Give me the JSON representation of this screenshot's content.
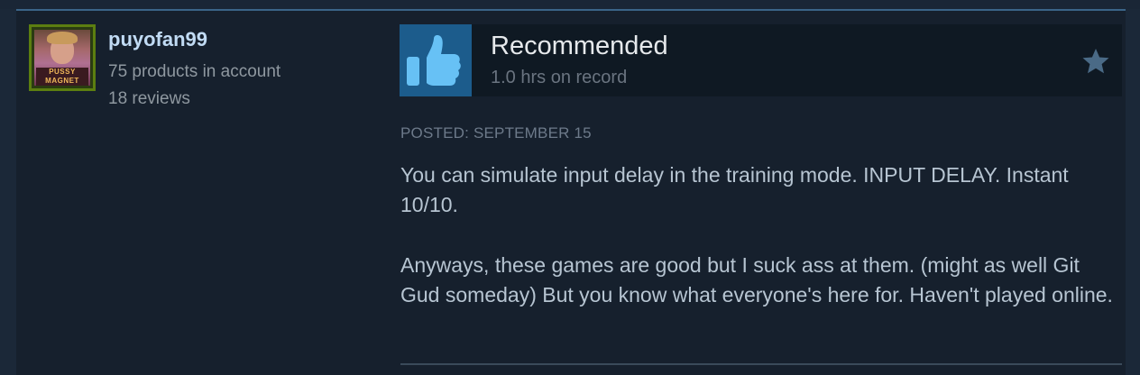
{
  "author": {
    "persona_name": "puyofan99",
    "products_in_account": "75 products in account",
    "reviews_count": "18 reviews",
    "avatar_caption": "PUSSY MAGNET"
  },
  "review": {
    "verdict": "Recommended",
    "hours_on_record": "1.0 hrs on record",
    "posted_date": "POSTED: SEPTEMBER 15",
    "paragraphs": [
      "You can simulate input delay in the training mode. INPUT DELAY. Instant 10/10.",
      "Anyways, these games are good but I suck ass at them. (might as well Git Gud someday) But you know what everyone's here for. Haven't played online."
    ]
  },
  "icons": {
    "thumb": "thumbs-up-icon",
    "star": "star-icon"
  },
  "colors": {
    "page_background": "#1b2838",
    "card_background": "#16202d",
    "accent_blue": "#1c5c8c",
    "persona_name": "#c1dbf4",
    "avatar_frame": "#5c7e10"
  }
}
